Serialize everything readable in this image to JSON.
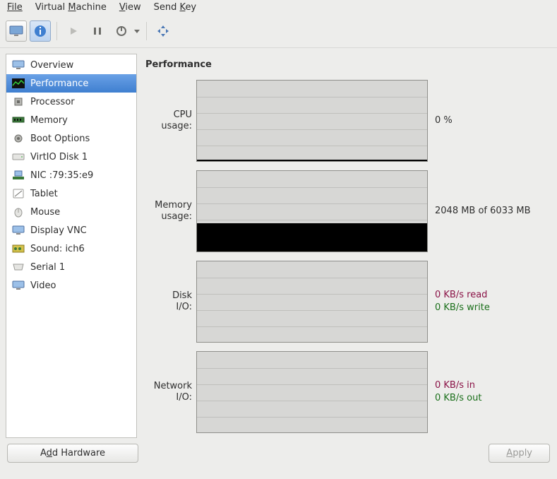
{
  "menubar": {
    "file": "File",
    "virtual_machine_pre": "Virtual ",
    "virtual_machine_key": "M",
    "virtual_machine_post": "achine",
    "view_key": "V",
    "view_post": "iew",
    "sendkey_pre": "Send ",
    "sendkey_key": "K",
    "sendkey_post": "ey"
  },
  "sidebar": {
    "items": [
      {
        "label": "Overview"
      },
      {
        "label": "Performance"
      },
      {
        "label": "Processor"
      },
      {
        "label": "Memory"
      },
      {
        "label": "Boot Options"
      },
      {
        "label": "VirtIO Disk 1"
      },
      {
        "label": "NIC :79:35:e9"
      },
      {
        "label": "Tablet"
      },
      {
        "label": "Mouse"
      },
      {
        "label": "Display VNC"
      },
      {
        "label": "Sound: ich6"
      },
      {
        "label": "Serial 1"
      },
      {
        "label": "Video"
      }
    ]
  },
  "content": {
    "title": "Performance",
    "cpu": {
      "label1": "CPU",
      "label2": "usage:",
      "value": "0 %"
    },
    "memory": {
      "label1": "Memory",
      "label2": "usage:",
      "value": "2048 MB of 6033 MB"
    },
    "disk": {
      "label1": "Disk",
      "label2": "I/O:",
      "read": "0 KB/s read",
      "write": "0 KB/s write"
    },
    "net": {
      "label1": "Network",
      "label2": "I/O:",
      "in": "0 KB/s in",
      "out": "0 KB/s out"
    }
  },
  "footer": {
    "add_hw_pre": "A",
    "add_hw_key": "d",
    "add_hw_post": "d Hardware",
    "apply_key": "A",
    "apply_post": "pply"
  },
  "chart_data": [
    {
      "type": "area",
      "name": "CPU usage",
      "ylim": [
        0,
        100
      ],
      "unit": "%",
      "current": 0,
      "history_fill_fraction": 0.02
    },
    {
      "type": "area",
      "name": "Memory usage",
      "ylim": [
        0,
        6033
      ],
      "unit": "MB",
      "current": 2048,
      "history_fill_fraction": 0.34
    },
    {
      "type": "area",
      "name": "Disk I/O",
      "unit": "KB/s",
      "read": 0,
      "write": 0
    },
    {
      "type": "area",
      "name": "Network I/O",
      "unit": "KB/s",
      "in": 0,
      "out": 0
    }
  ]
}
